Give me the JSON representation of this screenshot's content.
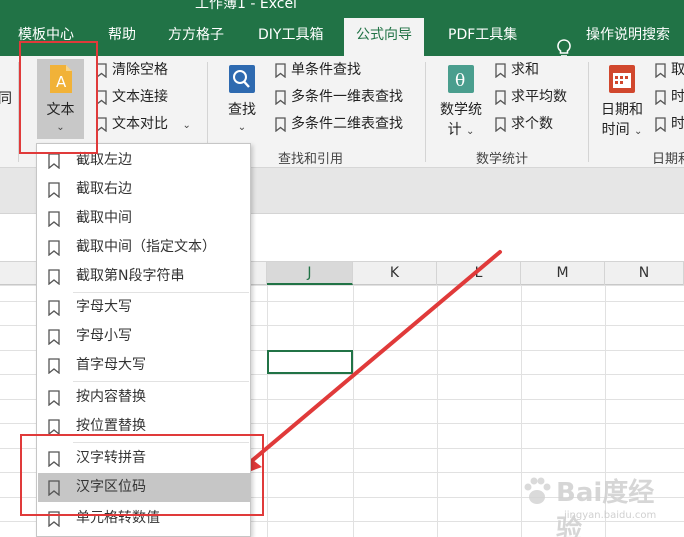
{
  "window": {
    "title": "工作簿1 - Excel"
  },
  "tabs": [
    {
      "label": "模板中心"
    },
    {
      "label": "帮助"
    },
    {
      "label": "方方格子"
    },
    {
      "label": "DIY工具箱"
    },
    {
      "label": "公式向导",
      "active": true
    },
    {
      "label": "PDF工具集"
    },
    {
      "label": "操作说明搜索"
    }
  ],
  "ribbon": {
    "left_cut_label": "同",
    "text_button": {
      "label": "文本",
      "icon": "letter-a-icon"
    },
    "text_tools": [
      "清除空格",
      "文本连接",
      "文本对比"
    ],
    "lookup_button": {
      "label": "查找",
      "icon": "magnifier-icon"
    },
    "lookup_tools": [
      "单条件查找",
      "多条件一维表查找",
      "多条件二维表查找"
    ],
    "lookup_group_label": "查找和引用",
    "math_button": {
      "label_line1": "数学统",
      "label_line2": "计",
      "icon": "theta-icon"
    },
    "math_tools": [
      "求和",
      "求平均数",
      "求个数"
    ],
    "math_group_label": "数学统计",
    "date_button": {
      "label_line1": "日期和",
      "label_line2": "时间",
      "icon": "calendar-icon"
    },
    "date_tools": [
      "取",
      "时",
      "时"
    ],
    "date_group_label": "日期和"
  },
  "columns": [
    "J",
    "K",
    "L",
    "M",
    "N"
  ],
  "selected_column": "J",
  "dropdown": {
    "items": [
      "截取左边",
      "截取右边",
      "截取中间",
      "截取中间（指定文本）",
      "截取第N段字符串",
      "字母大写",
      "字母小写",
      "首字母大写",
      "按内容替换",
      "按位置替换",
      "汉字转拼音",
      "汉字区位码",
      "单元格转数值"
    ],
    "hovered_item": "汉字区位码"
  },
  "colors": {
    "accent_green": "#217346",
    "highlight_red": "#e03a3a",
    "ribbon_bg": "#f3f3f3"
  },
  "watermark": {
    "brand": "Bai度经验",
    "url": "jingyan.baidu.com"
  }
}
